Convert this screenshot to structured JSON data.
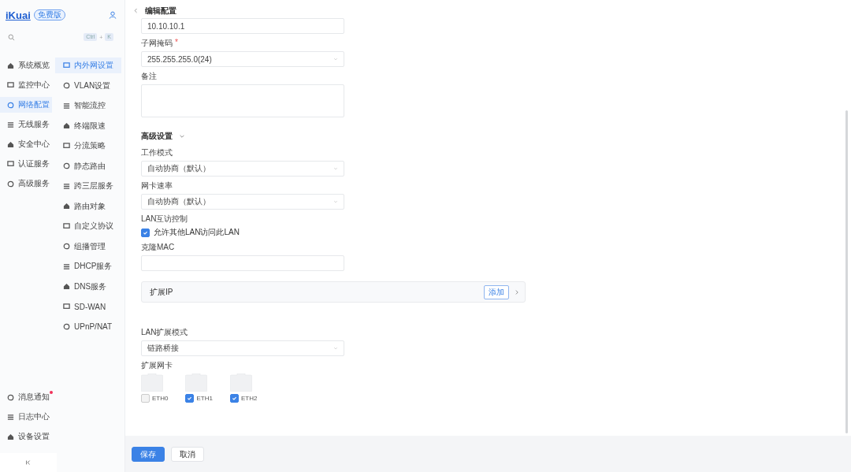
{
  "sidebar": {
    "logo": "iKuai",
    "edition": "免费版",
    "shortcut": {
      "key1": "Ctrl",
      "plus": "+",
      "key2": "K"
    },
    "menu": [
      {
        "label": "系统概览",
        "selected": false
      },
      {
        "label": "监控中心",
        "selected": false
      },
      {
        "label": "网络配置",
        "selected": true
      },
      {
        "label": "无线服务",
        "selected": false
      },
      {
        "label": "安全中心",
        "selected": false
      },
      {
        "label": "认证服务",
        "selected": false
      },
      {
        "label": "高级服务",
        "selected": false
      }
    ],
    "submenu": [
      {
        "label": "内外网设置",
        "selected": true
      },
      {
        "label": "VLAN设置",
        "selected": false
      },
      {
        "label": "智能流控",
        "selected": false
      },
      {
        "label": "终端限速",
        "selected": false
      },
      {
        "label": "分流策略",
        "selected": false
      },
      {
        "label": "静态路由",
        "selected": false
      },
      {
        "label": "跨三层服务",
        "selected": false
      },
      {
        "label": "路由对象",
        "selected": false
      },
      {
        "label": "自定义协议",
        "selected": false
      },
      {
        "label": "组播管理",
        "selected": false
      },
      {
        "label": "DHCP服务",
        "selected": false
      },
      {
        "label": "DNS服务",
        "selected": false
      },
      {
        "label": "SD-WAN",
        "selected": false
      },
      {
        "label": "UPnP/NAT",
        "selected": false
      }
    ],
    "bottom": [
      {
        "label": "消息通知",
        "badge": true
      },
      {
        "label": "日志中心",
        "badge": false
      },
      {
        "label": "设备设置",
        "badge": false
      }
    ]
  },
  "form": {
    "title": "编辑配置",
    "fields": [
      {
        "kind": "input",
        "value": "10.10.10.1"
      },
      {
        "kind": "select",
        "label": "子网掩码",
        "required_mark": "*",
        "value": "255.255.255.0(24)"
      },
      {
        "kind": "textarea",
        "label": "备注"
      },
      {
        "kind": "section",
        "label": "高级设置",
        "expanded": true
      },
      {
        "kind": "select",
        "label": "工作模式",
        "value": "自动协商（默认）"
      },
      {
        "kind": "select",
        "label": "网卡速率",
        "value": "自动协商（默认）"
      },
      {
        "kind": "checkbox",
        "label": "LAN互访控制",
        "option": "允许其他LAN访问此LAN",
        "checked": true
      },
      {
        "kind": "input",
        "label": "克隆MAC"
      },
      {
        "kind": "panel",
        "label": "扩展IP",
        "button": "添加"
      },
      {
        "kind": "select",
        "label": "LAN扩展模式",
        "value": "链路桥接"
      },
      {
        "kind": "nics",
        "label": "扩展网卡",
        "items": [
          {
            "name": "ETH0",
            "checked": false
          },
          {
            "name": "ETH1",
            "checked": true
          },
          {
            "name": "ETH2",
            "checked": true
          }
        ]
      }
    ]
  },
  "buttons": [
    {
      "label": "保存",
      "kind": "primary"
    },
    {
      "label": "取消",
      "kind": "default"
    }
  ]
}
